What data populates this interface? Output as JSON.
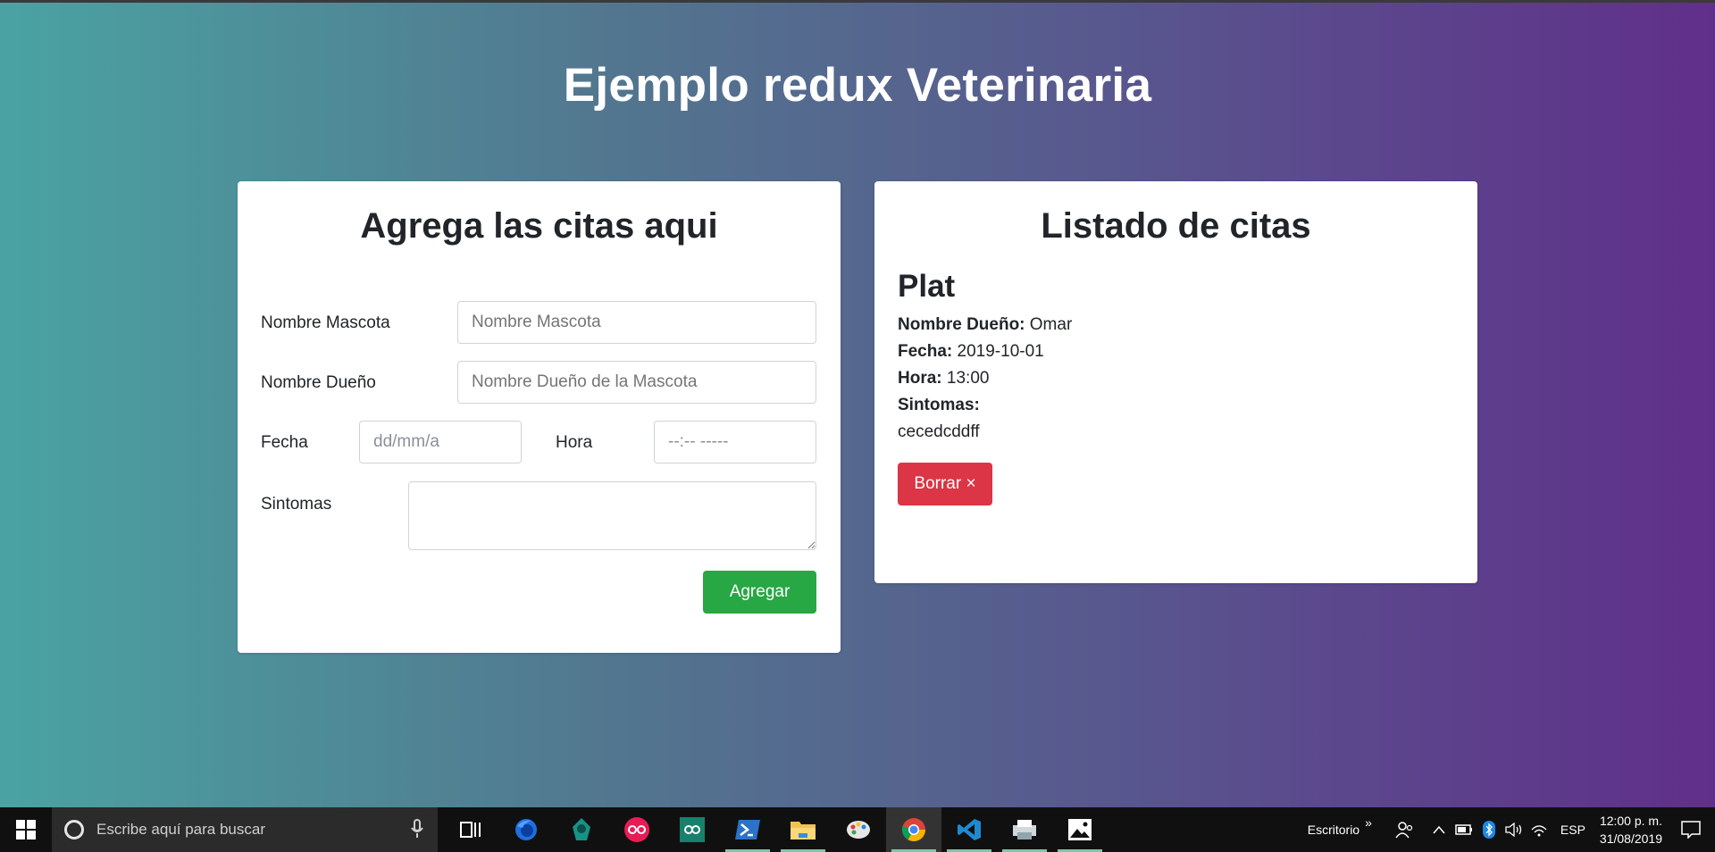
{
  "app": {
    "title": "Ejemplo redux Veterinaria"
  },
  "form": {
    "title": "Agrega las citas aqui",
    "pet_label": "Nombre Mascota",
    "pet_placeholder": "Nombre Mascota",
    "owner_label": "Nombre Dueño",
    "owner_placeholder": "Nombre Dueño de la Mascota",
    "date_label": "Fecha",
    "date_value": "dd/mm/a",
    "time_label": "Hora",
    "time_value": "--:-- -----",
    "symptoms_label": "Sintomas",
    "symptoms_value": "",
    "submit_label": "Agregar"
  },
  "list": {
    "title": "Listado de citas",
    "appointments": [
      {
        "pet": "Plat",
        "owner_label": "Nombre Dueño:",
        "owner": "Omar",
        "date_label": "Fecha:",
        "date": "2019-10-01",
        "time_label": "Hora:",
        "time": "13:00",
        "symptoms_label": "Sintomas:",
        "symptoms": "cecedcddff",
        "delete_label": "Borrar ×"
      }
    ]
  },
  "taskbar": {
    "search_placeholder": "Escribe aquí para buscar",
    "desktop_label": "Escritorio",
    "chevron": "»",
    "language": "ESP",
    "time": "12:00 p. m.",
    "date": "31/08/2019",
    "apps": [
      "task-view",
      "firefox",
      "gitkraken",
      "flickr",
      "arduino",
      "powershell",
      "file-explorer",
      "paint",
      "chrome",
      "vscode",
      "app-misc",
      "photos"
    ]
  },
  "colors": {
    "success": "#28a745",
    "danger": "#dc3545",
    "gradient_start": "#4aa3a2",
    "gradient_end": "#602f8a"
  }
}
